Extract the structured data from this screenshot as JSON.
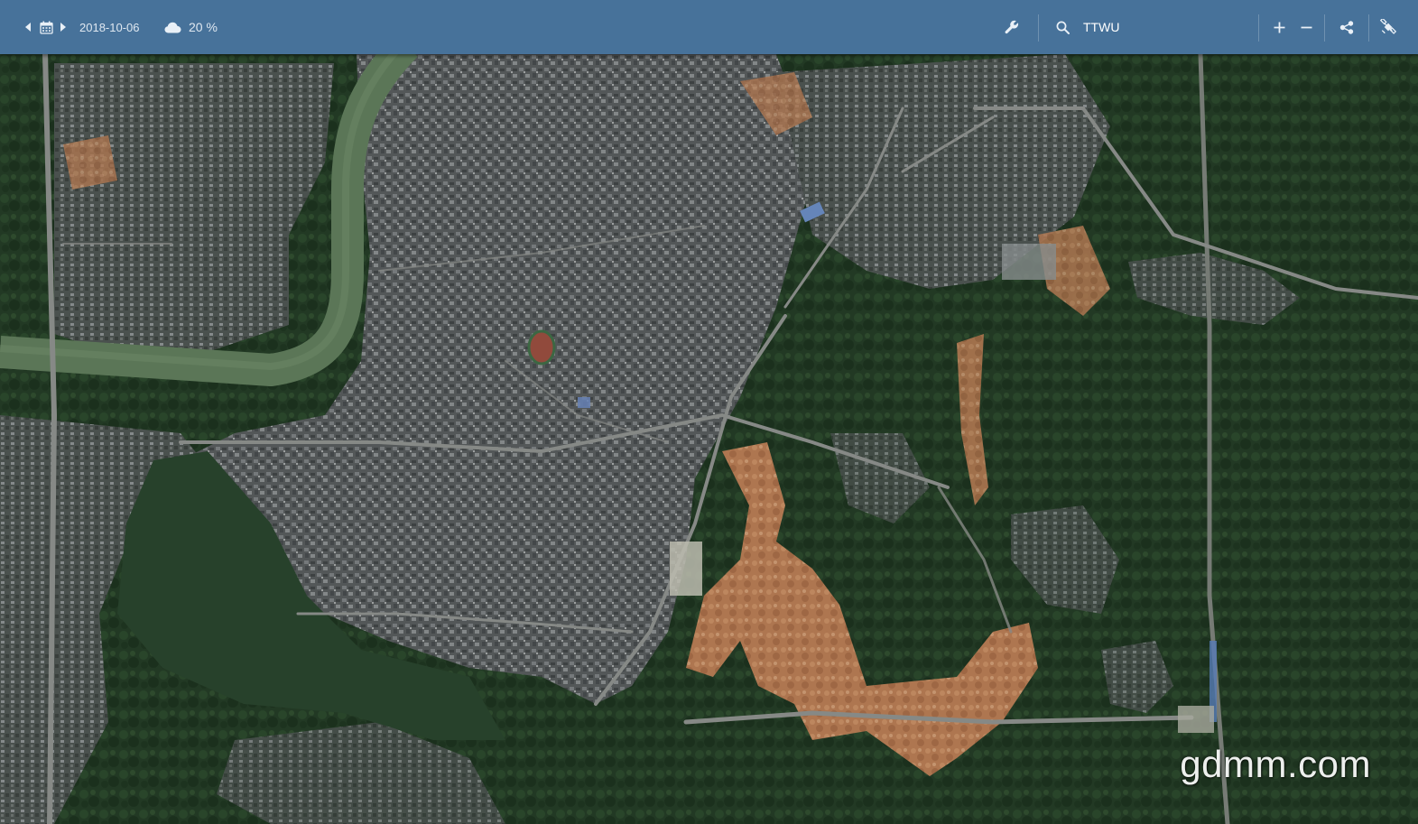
{
  "toolbar": {
    "date": "2018-10-06",
    "cloud_cover": "20 %",
    "search_value": "TTWU",
    "icons": {
      "prev": "caret-left-icon",
      "calendar": "calendar-icon",
      "next": "caret-right-icon",
      "cloud": "cloud-icon",
      "tools": "wrench-icon",
      "search": "search-icon",
      "zoom_in": "plus-icon",
      "zoom_out": "minus-icon",
      "share": "share-icon",
      "satellite": "satellite-icon"
    }
  },
  "map": {
    "watermark": "gdmm.com"
  },
  "colors": {
    "toolbar_bg": "#47729a",
    "toolbar_text": "#dfe8f1",
    "vegetation": "#1f3420",
    "urban": "#55575a",
    "river": "#5f7a5a",
    "bare_soil": "#b8744c"
  }
}
